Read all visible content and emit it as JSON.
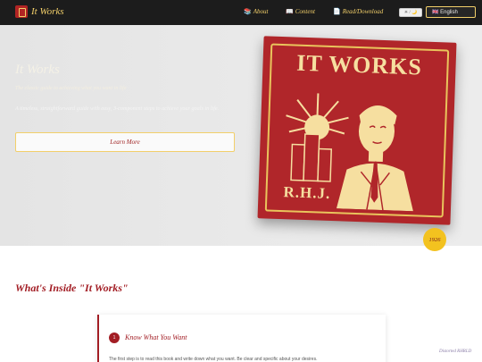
{
  "nav": {
    "brand": "It Works",
    "links": [
      {
        "icon": "book-icon",
        "glyph": "📚",
        "label": "About"
      },
      {
        "icon": "open-book-icon",
        "glyph": "📖",
        "label": "Content"
      },
      {
        "icon": "page-icon",
        "glyph": "📄",
        "label": "Read/Download"
      }
    ],
    "theme_toggle": "☀ / 🌙",
    "language": "🇬🇧 English"
  },
  "hero": {
    "title": "It Works",
    "subtitle": "The classic guide to achieving what you want in life",
    "description": "A timeless, straightforward guide with easy, 3-component steps to achieve your goals in life.",
    "button_label": "Learn More",
    "book": {
      "title": "IT WORKS",
      "author": "R.H.J.",
      "year": "1926"
    }
  },
  "section": {
    "title": "What's Inside \"It Works\"",
    "card": {
      "number": "1",
      "title": "Know What You Want",
      "text": "The first step is to read this book and write down what you want. Be clear and specific about your desires."
    }
  },
  "footer_note": "Distorted RHRLD",
  "colors": {
    "nav_bg": "#1c1c1c",
    "gold": "#f2cf6a",
    "crimson": "#a21d24",
    "book_red": "#b0262a",
    "badge_yellow": "#f3c21f"
  }
}
